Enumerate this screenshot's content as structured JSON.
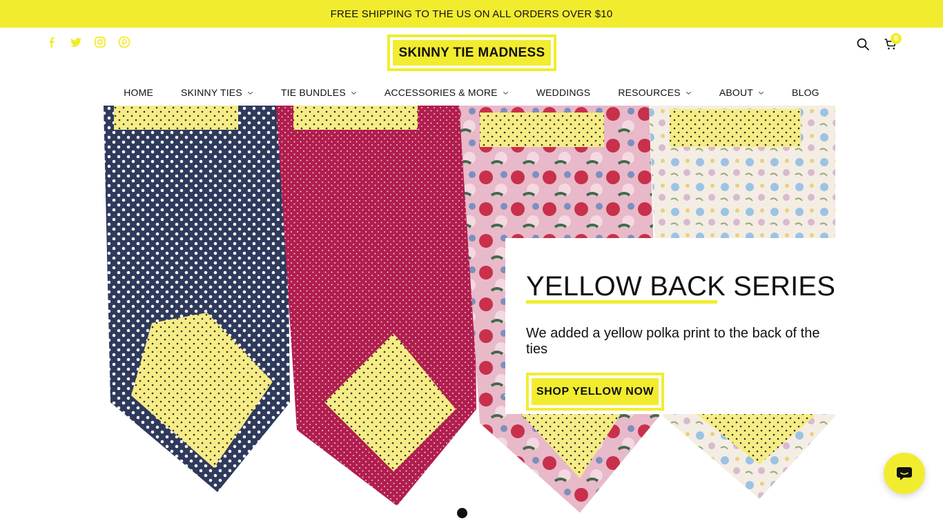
{
  "announcement": "FREE SHIPPING TO THE US ON ALL ORDERS OVER $10",
  "brand": {
    "logo_text": "SKINNY TIE MADNESS",
    "accent": "#f2ec2f",
    "text": "#111111"
  },
  "social": [
    "facebook-icon",
    "twitter-icon",
    "instagram-icon",
    "pinterest-icon"
  ],
  "header": {
    "cart_count": "0"
  },
  "nav": {
    "items": [
      {
        "label": "HOME"
      },
      {
        "label": "SKINNY TIES"
      },
      {
        "label": "TIE BUNDLES"
      },
      {
        "label": "ACCESSORIES & MORE"
      },
      {
        "label": "WEDDINGS"
      },
      {
        "label": "RESOURCES"
      },
      {
        "label": "ABOUT"
      },
      {
        "label": "BLOG"
      }
    ]
  },
  "hero": {
    "title": "YELLOW BACK SERIES",
    "subtitle": "We added a yellow polka print to the back of the ties",
    "cta": "SHOP YELLOW NOW",
    "tie_colors": [
      "#2f3a5c",
      "#b01e4e",
      "#c8465a",
      "#efe4da"
    ]
  }
}
